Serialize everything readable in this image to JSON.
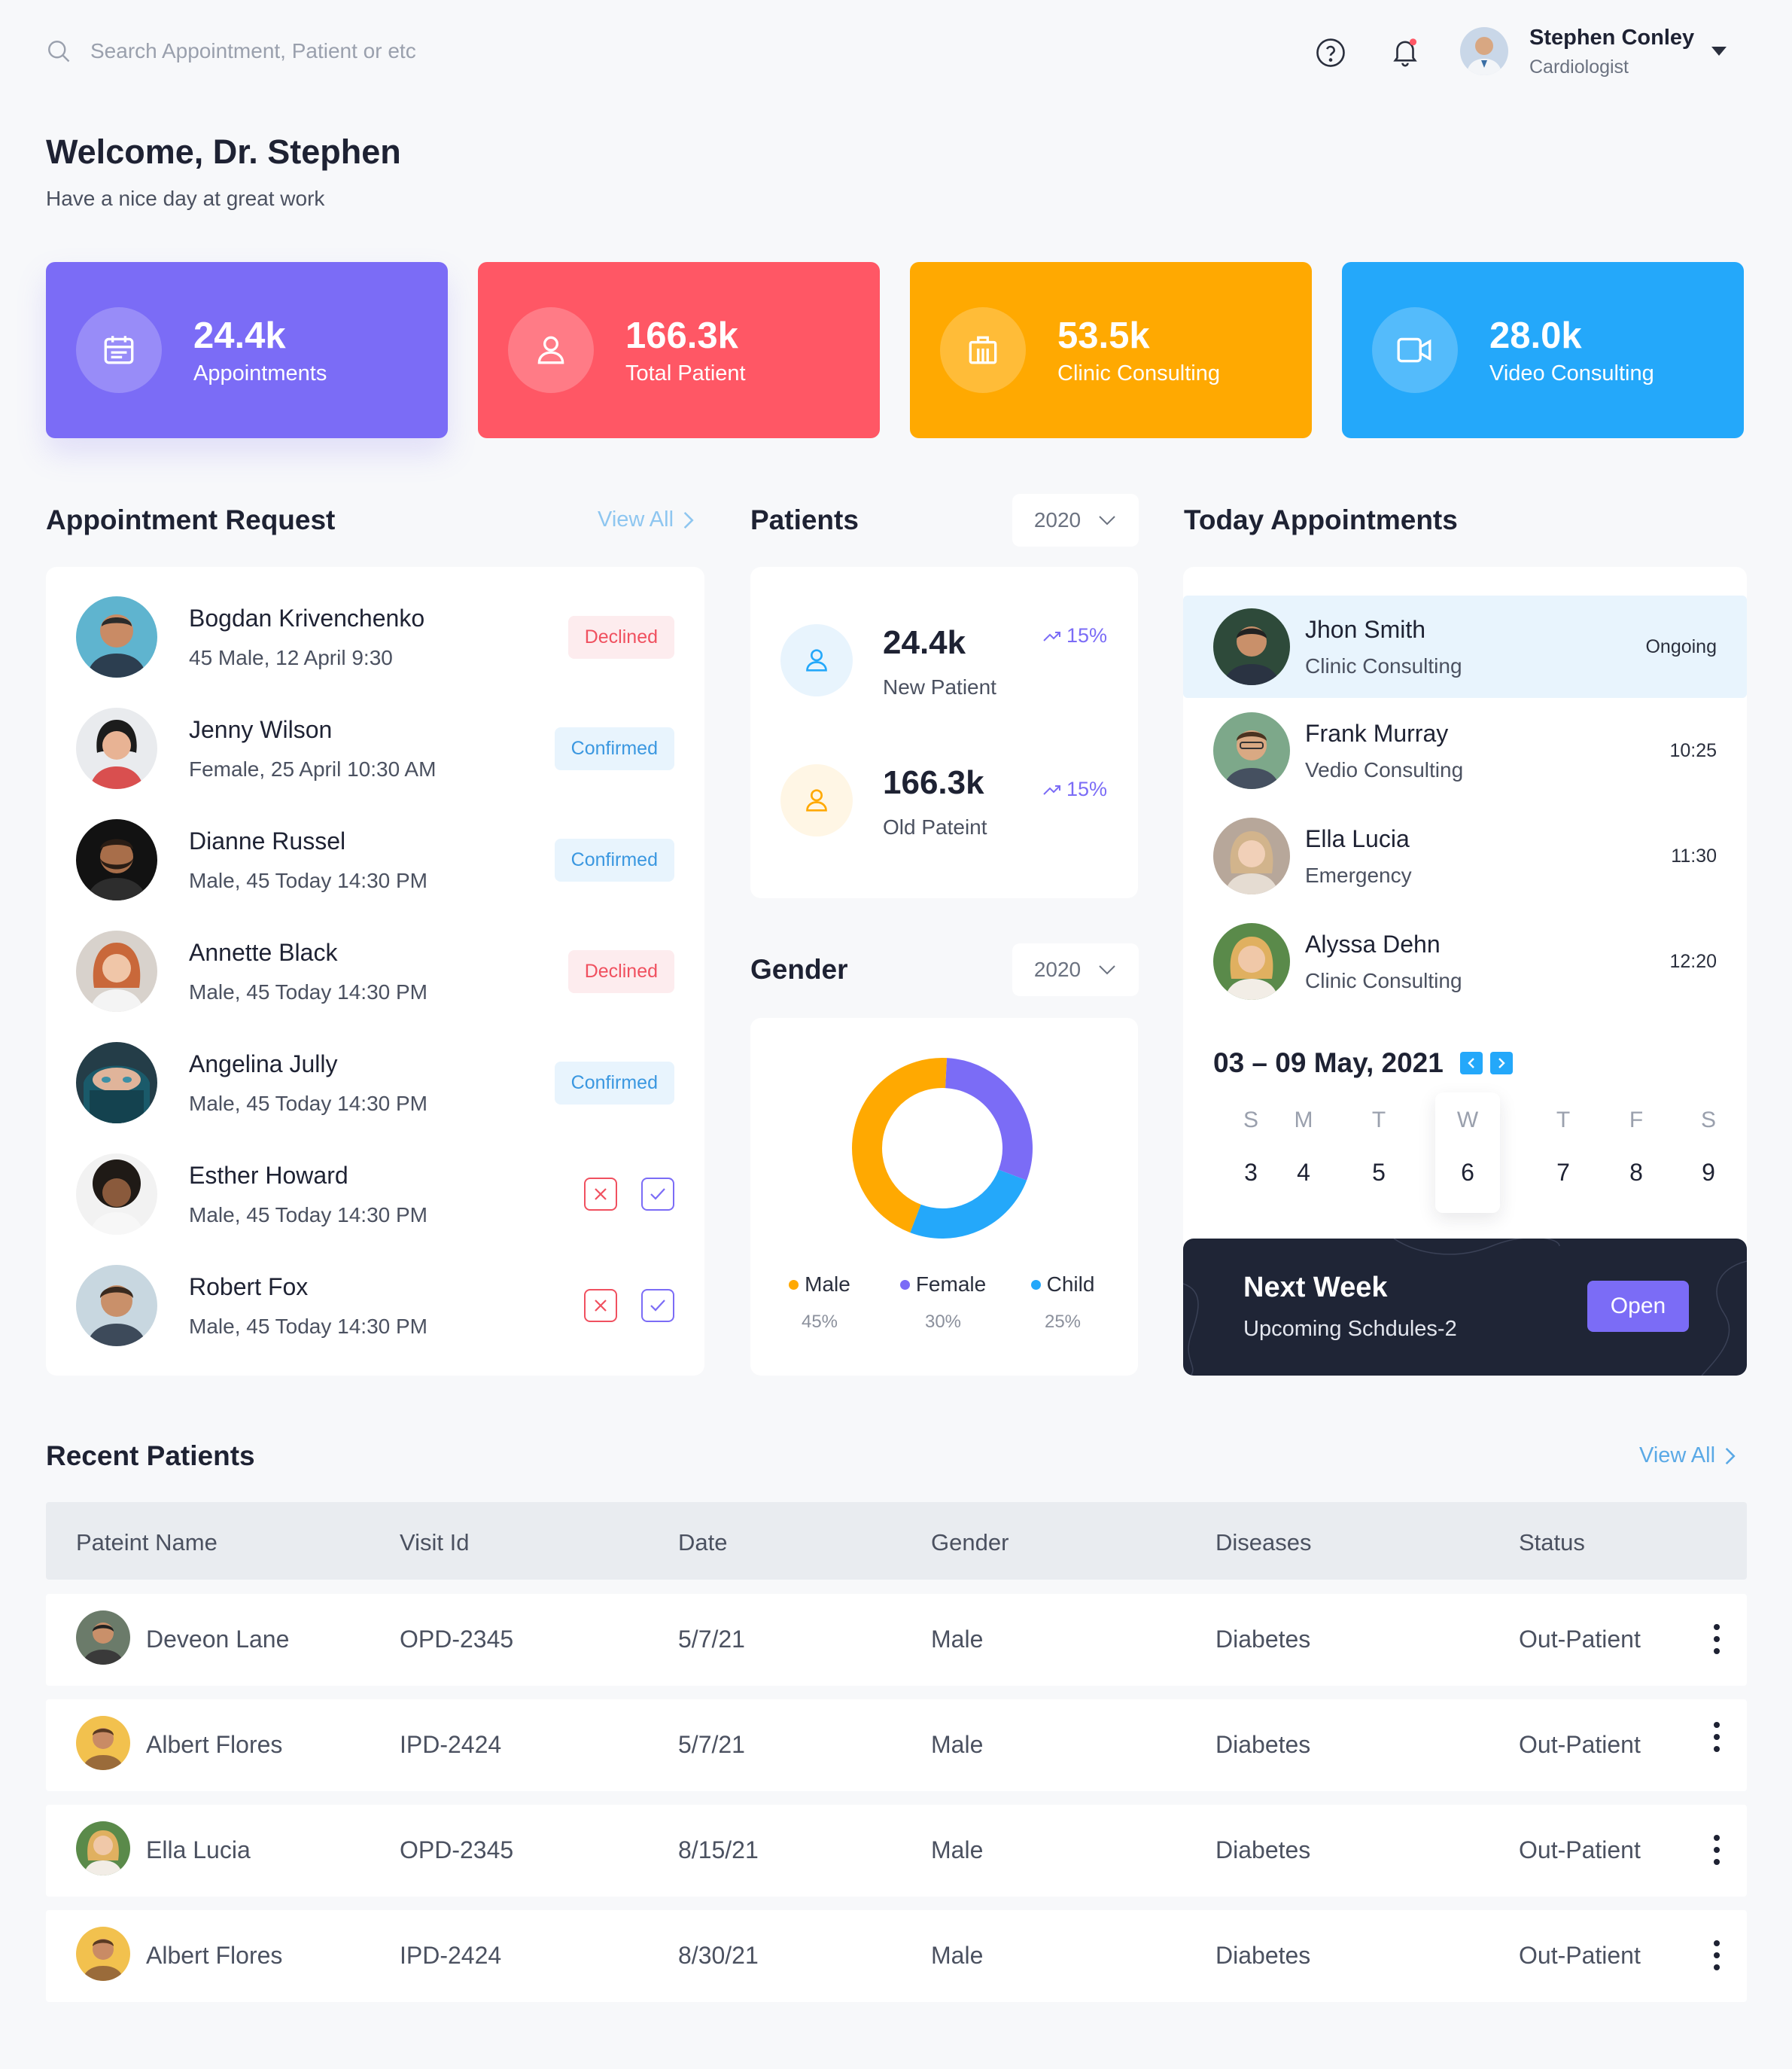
{
  "search": {
    "placeholder": "Search Appointment, Patient or etc",
    "icon": "search-icon"
  },
  "header": {
    "help_icon": "question-circle-icon",
    "bell_icon": "bell-icon",
    "profile": {
      "name": "Stephen Conley",
      "role": "Cardiologist"
    }
  },
  "welcome": {
    "title": "Welcome, Dr. Stephen",
    "subtitle": "Have a nice day at great work"
  },
  "stats": [
    {
      "value": "24.4k",
      "label": "Appointments",
      "color": "#7b6cf6",
      "icon": "calendar-icon"
    },
    {
      "value": "166.3k",
      "label": "Total Patient",
      "color": "#ff5765",
      "icon": "user-icon"
    },
    {
      "value": "53.5k",
      "label": "Clinic Consulting",
      "color": "#ffa901",
      "icon": "hospital-icon"
    },
    {
      "value": "28.0k",
      "label": "Video Consulting",
      "color": "#24a8fa",
      "icon": "video-icon"
    }
  ],
  "appointment_request": {
    "title": "Appointment Request",
    "view_all": "View All",
    "items": [
      {
        "name": "Bogdan Krivenchenko",
        "meta": "45 Male, 12 April 9:30",
        "status": "Declined"
      },
      {
        "name": "Jenny Wilson",
        "meta": "Female, 25 April 10:30 AM",
        "status": "Confirmed"
      },
      {
        "name": "Dianne Russel",
        "meta": "Male, 45 Today 14:30 PM",
        "status": "Confirmed"
      },
      {
        "name": "Annette Black",
        "meta": "Male, 45 Today 14:30 PM",
        "status": "Declined"
      },
      {
        "name": "Angelina Jully",
        "meta": "Male, 45 Today 14:30 PM",
        "status": "Confirmed"
      },
      {
        "name": "Esther Howard",
        "meta": "Male, 45 Today 14:30 PM",
        "status": ""
      },
      {
        "name": "Robert Fox",
        "meta": "Male, 45 Today 14:30 PM",
        "status": ""
      }
    ]
  },
  "patients": {
    "title": "Patients",
    "year": "2020",
    "new": {
      "value": "24.4k",
      "label": "New Patient",
      "trend": "15%"
    },
    "old": {
      "value": "166.3k",
      "label": "Old Pateint",
      "trend": "15%"
    }
  },
  "gender": {
    "title": "Gender",
    "year": "2020",
    "segments": [
      {
        "name": "Male",
        "pct": "45%",
        "share": 0.45,
        "color": "#ffa901"
      },
      {
        "name": "Female",
        "pct": "30%",
        "share": 0.3,
        "color": "#7b6cf6"
      },
      {
        "name": "Child",
        "pct": "25%",
        "share": 0.25,
        "color": "#24a8fa"
      }
    ]
  },
  "today": {
    "title": "Today Appointments",
    "items": [
      {
        "name": "Jhon Smith",
        "type": "Clinic Consulting",
        "time": "Ongoing"
      },
      {
        "name": "Frank Murray",
        "type": "Vedio Consulting",
        "time": "10:25"
      },
      {
        "name": "Ella Lucia",
        "type": "Emergency",
        "time": "11:30"
      },
      {
        "name": "Alyssa Dehn",
        "type": "Clinic Consulting",
        "time": "12:20"
      }
    ],
    "week_label": "03 – 09 May, 2021",
    "days": [
      {
        "l": "S",
        "n": "3"
      },
      {
        "l": "M",
        "n": "4"
      },
      {
        "l": "T",
        "n": "5"
      },
      {
        "l": "W",
        "n": "6"
      },
      {
        "l": "T",
        "n": "7"
      },
      {
        "l": "F",
        "n": "8"
      },
      {
        "l": "S",
        "n": "9"
      }
    ],
    "next_week": {
      "title": "Next Week",
      "subtitle": "Upcoming Schdules-2",
      "button": "Open"
    }
  },
  "recent": {
    "title": "Recent Patients",
    "view_all": "View All",
    "columns": [
      "Pateint Name",
      "Visit Id",
      "Date",
      "Gender",
      "Diseases",
      "Status"
    ],
    "rows": [
      {
        "name": "Deveon Lane",
        "visit": "OPD-2345",
        "date": "5/7/21",
        "gender": "Male",
        "disease": "Diabetes",
        "status": "Out-Patient"
      },
      {
        "name": "Albert Flores",
        "visit": "IPD-2424",
        "date": "5/7/21",
        "gender": "Male",
        "disease": "Diabetes",
        "status": "Out-Patient"
      },
      {
        "name": "Ella Lucia",
        "visit": "OPD-2345",
        "date": "8/15/21",
        "gender": "Male",
        "disease": "Diabetes",
        "status": "Out-Patient"
      },
      {
        "name": "Albert Flores",
        "visit": "IPD-2424",
        "date": "8/30/21",
        "gender": "Male",
        "disease": "Diabetes",
        "status": "Out-Patient"
      }
    ]
  }
}
